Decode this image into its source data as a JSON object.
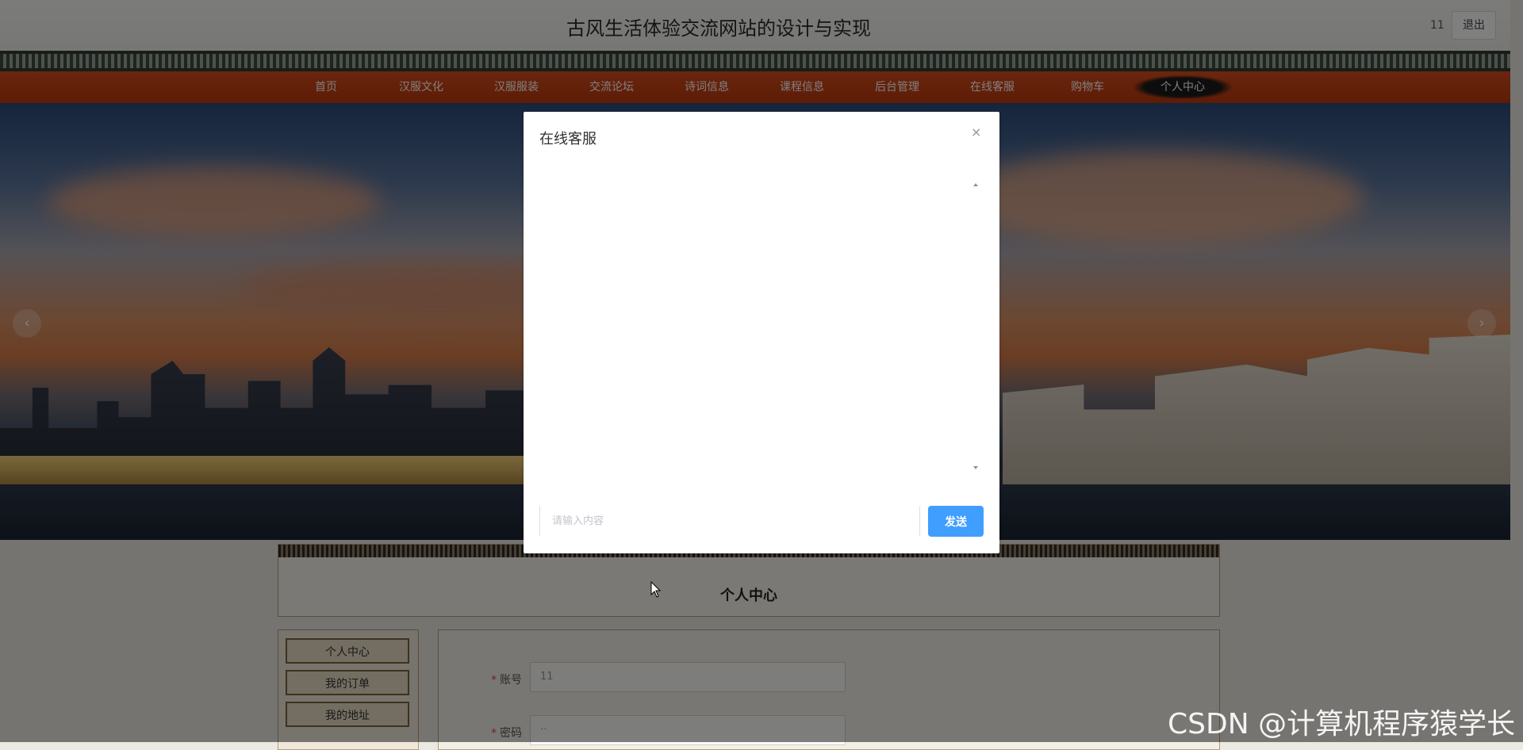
{
  "header": {
    "site_title": "古风生活体验交流网站的设计与实现",
    "user_name": "11",
    "logout_label": "退出"
  },
  "nav": {
    "items": [
      "首页",
      "汉服文化",
      "汉服服装",
      "交流论坛",
      "诗词信息",
      "课程信息",
      "后台管理",
      "在线客服",
      "购物车",
      "个人中心"
    ],
    "active_index": 9
  },
  "carousel": {
    "prev_icon": "chevron-left-icon",
    "next_icon": "chevron-right-icon",
    "prev_glyph": "‹",
    "next_glyph": "›"
  },
  "personal_center": {
    "title": "个人中心",
    "menu": [
      "个人中心",
      "我的订单",
      "我的地址"
    ],
    "form": {
      "account_label": "账号",
      "account_value": "11",
      "password_label": "密码",
      "password_value": "··"
    }
  },
  "dialog": {
    "title": "在线客服",
    "close_glyph": "×",
    "input_placeholder": "请输入内容",
    "send_label": "发送"
  },
  "watermark": "CSDN @计算机程序猿学长",
  "colors": {
    "nav_red": "#c6421a",
    "primary_blue": "#409eff",
    "required_star": "#e04040"
  }
}
